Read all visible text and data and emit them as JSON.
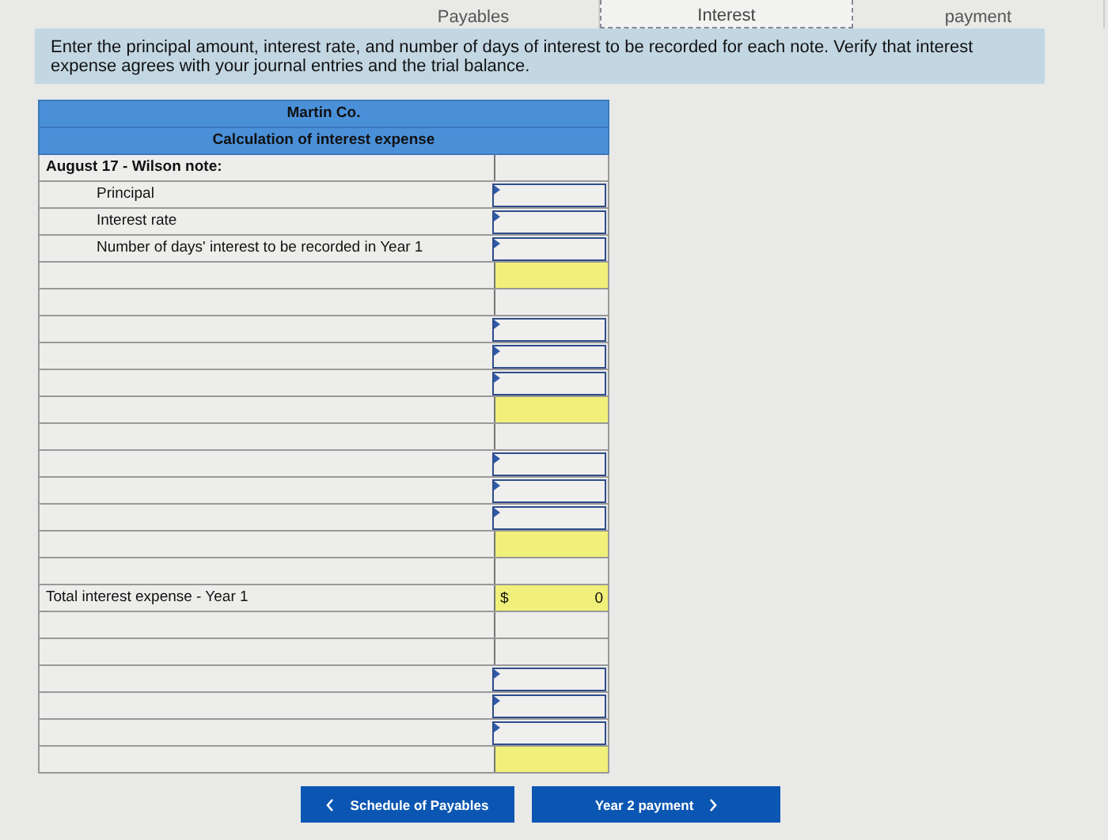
{
  "tabs": [
    {
      "label": "Payables",
      "selected": false
    },
    {
      "label": "Interest",
      "selected": true
    },
    {
      "label": "payment",
      "selected": false
    }
  ],
  "instructions": "Enter the principal amount, interest rate, and number of days of interest to be recorded for each note.  Verify that interest expense agrees with your journal entries and the trial balance.",
  "worksheet": {
    "company": "Martin Co.",
    "title": "Calculation of interest expense",
    "rows": [
      {
        "kind": "plain",
        "label": "August 17 - Wilson note:",
        "children": [
          {
            "kind": "input",
            "label": "Principal"
          },
          {
            "kind": "input",
            "label": "Interest rate"
          },
          {
            "kind": "input",
            "label": "Number of days' interest to be recorded in Year 1"
          }
        ]
      },
      {
        "kind": "total"
      },
      {
        "kind": "plain"
      },
      {
        "kind": "input"
      },
      {
        "kind": "input"
      },
      {
        "kind": "input"
      },
      {
        "kind": "total"
      },
      {
        "kind": "plain"
      },
      {
        "kind": "input"
      },
      {
        "kind": "input"
      },
      {
        "kind": "input"
      },
      {
        "kind": "total"
      },
      {
        "kind": "plain"
      },
      {
        "kind": "total",
        "label": "Total interest expense - Year 1",
        "currency": "$",
        "value": "0"
      },
      {
        "kind": "plain"
      },
      {
        "kind": "plain"
      },
      {
        "kind": "input"
      },
      {
        "kind": "input"
      },
      {
        "kind": "input"
      },
      {
        "kind": "total"
      }
    ]
  },
  "nav": [
    {
      "label": "Schedule of Payables",
      "kind": "back"
    },
    {
      "label": "Year 2 payment",
      "kind": "next"
    }
  ]
}
